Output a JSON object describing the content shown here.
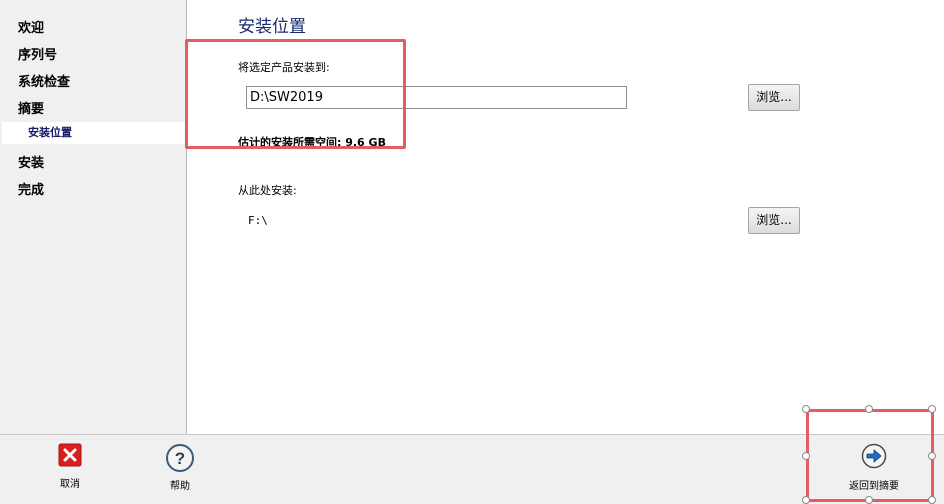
{
  "sidebar": {
    "items": [
      {
        "label": "欢迎"
      },
      {
        "label": "序列号"
      },
      {
        "label": "系统检查"
      },
      {
        "label": "摘要"
      },
      {
        "label": "安装位置"
      },
      {
        "label": "安装"
      },
      {
        "label": "完成"
      }
    ]
  },
  "main": {
    "title": "安装位置",
    "install_to_label": "将选定产品安装到:",
    "install_path": "D:\\SW2019",
    "browse_label": "浏览...",
    "space_required": "估计的安装所需空间: 9.6 GB",
    "install_from_label": "从此处安装:",
    "source_path": "F:\\",
    "browse_label_2": "浏览..."
  },
  "bottom": {
    "cancel_label": "取消",
    "help_label": "帮助",
    "back_label": "返回到摘要"
  },
  "colors": {
    "annotation": "#e45d62",
    "title": "#1a2a6e",
    "cancel_icon": "#d81e1e",
    "back_icon": "#1e6fc4"
  },
  "icons": [
    "close-icon",
    "help-icon",
    "arrow-right-icon"
  ]
}
